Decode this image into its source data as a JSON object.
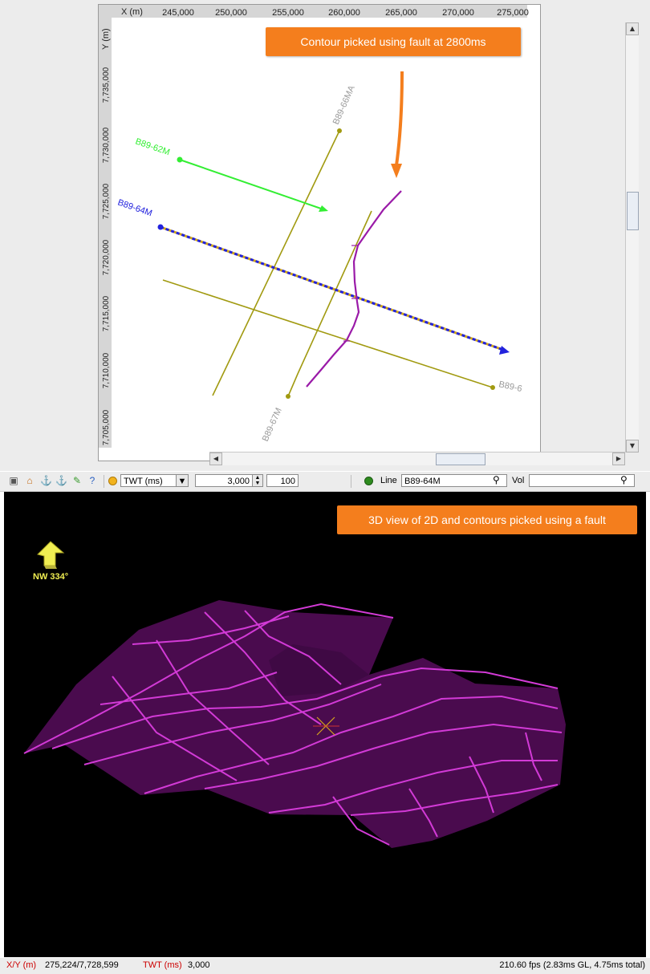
{
  "map": {
    "x_axis_label": "X (m)",
    "y_axis_label": "Y (m)",
    "x_ticks": [
      "245,000",
      "250,000",
      "255,000",
      "260,000",
      "265,000",
      "270,000",
      "275,000"
    ],
    "y_ticks": [
      "7,735,000",
      "7,730,000",
      "7,725,000",
      "7,720,000",
      "7,715,000",
      "7,710,000",
      "7,705,000"
    ],
    "lines": [
      {
        "name": "B89-62M",
        "color": "#33ee33"
      },
      {
        "name": "B89-64M",
        "color": "#2222dd"
      },
      {
        "name": "B89-66MA",
        "color": "#999999"
      },
      {
        "name": "B89-67M",
        "color": "#999999"
      },
      {
        "name": "B89-6",
        "color": "#999999"
      }
    ],
    "contour_color": "#9a1aa8",
    "track_color": "#a19a10",
    "callout": "Contour picked using fault at 2800ms"
  },
  "toolbar": {
    "domain_select": "TWT (ms)",
    "time_value": "3,000",
    "step_value": "100",
    "line_label": "Line",
    "line_value": "B89-64M",
    "vol_label": "Vol",
    "vol_value": ""
  },
  "viewer": {
    "callout": "3D view of 2D and contours picked using a fault",
    "compass_label": "NW 334°",
    "surface_color": "#4a0b4e",
    "contour_color": "#d23ad6"
  },
  "status": {
    "xy_label": "X/Y (m)",
    "xy_value": "275,224/7,728,599",
    "twt_label": "TWT (ms)",
    "twt_value": "3,000",
    "fps": "210.60 fps (2.83ms GL, 4.75ms total)"
  }
}
